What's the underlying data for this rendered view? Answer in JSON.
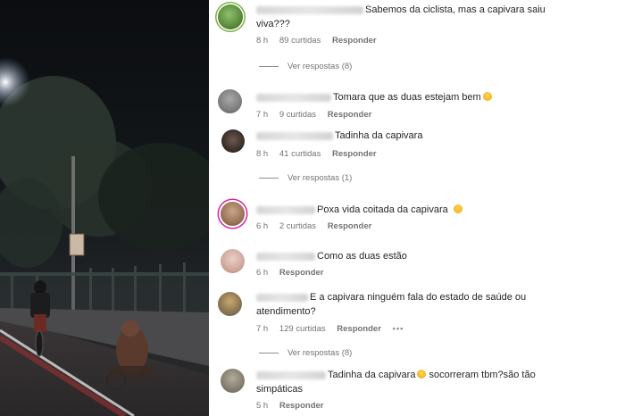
{
  "comments": [
    {
      "text": "Sabemos da ciclista, mas a capivara saiu viva???",
      "time": "8 h",
      "likes": "89 curtidas",
      "reply": "Responder"
    },
    {
      "text": "Tomara que as duas estejam bem",
      "time": "7 h",
      "likes": "9 curtidas",
      "reply": "Responder"
    },
    {
      "text": "Tadinha da capivara",
      "time": "8 h",
      "likes": "41 curtidas",
      "reply": "Responder"
    },
    {
      "text": "Poxa vida coitada da capivara",
      "time": "6 h",
      "likes": "2 curtidas",
      "reply": "Responder"
    },
    {
      "text": "Como as duas estão",
      "time": "6 h",
      "reply": "Responder"
    },
    {
      "text": "E a capivara ninguém fala do estado de saúde ou atendimento?",
      "time": "7 h",
      "likes": "129 curtidas",
      "reply": "Responder",
      "more": "•••"
    },
    {
      "text": "Tadinha da capivara",
      "text2": "socorreram tbm?são tão simpáticas",
      "time": "5 h",
      "reply": "Responder"
    }
  ],
  "view_replies": [
    "Ver respostas (8)",
    "Ver respostas (1)",
    "Ver respostas (8)"
  ]
}
